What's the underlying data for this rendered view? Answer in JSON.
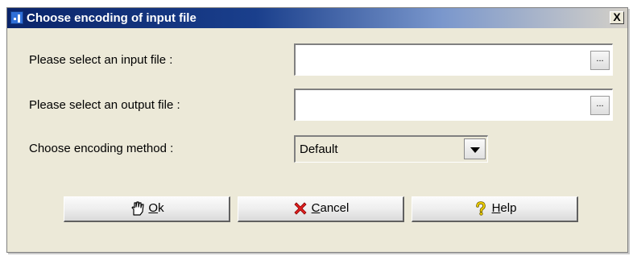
{
  "window": {
    "title": "Choose encoding of input file",
    "close_label": "X",
    "icon": "app-info-icon"
  },
  "form": {
    "input_label": "Please select an input file :",
    "input_value": "",
    "input_browse_label": "...",
    "output_label": "Please select an output file :",
    "output_value": "",
    "output_browse_label": "...",
    "encoding_label": "Choose encoding method :",
    "encoding_selected": "Default"
  },
  "buttons": {
    "ok": {
      "mnemonic": "O",
      "rest": "k",
      "icon": "pointing-hand-icon"
    },
    "cancel": {
      "mnemonic": "C",
      "rest": "ancel",
      "icon": "red-x-icon"
    },
    "help": {
      "mnemonic": "H",
      "rest": "elp",
      "icon": "question-mark-icon"
    }
  },
  "colors": {
    "titlebar": "#0a246a",
    "dialog_bg": "#ece9d8",
    "cancel_icon": "#e02020",
    "help_icon": "#f0d000"
  }
}
